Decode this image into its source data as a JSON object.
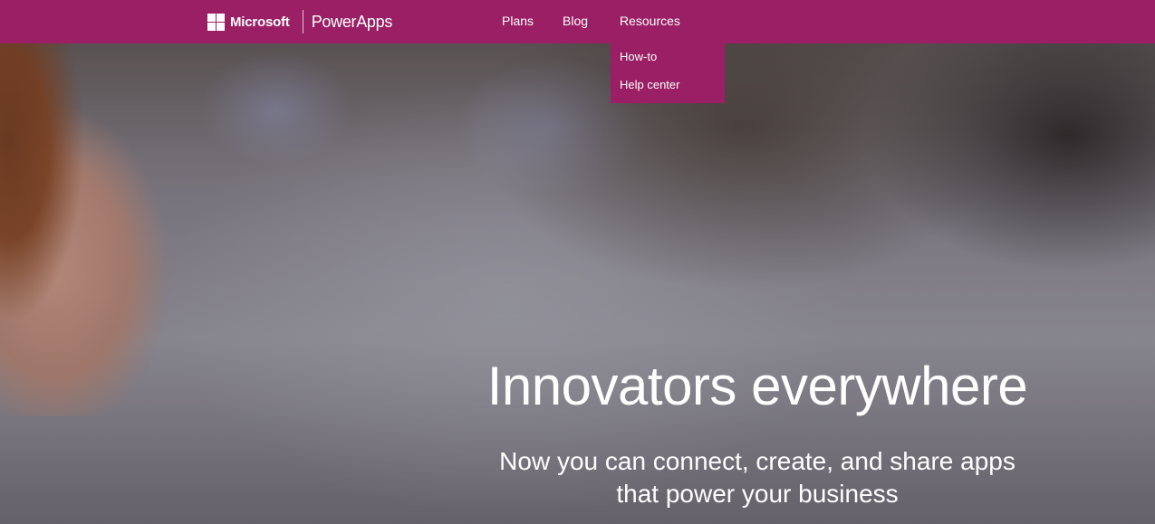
{
  "brand": {
    "company": "Microsoft",
    "product": "PowerApps",
    "logo_icon": "microsoft-four-squares-icon"
  },
  "nav": {
    "items": [
      {
        "label": "Plans"
      },
      {
        "label": "Blog"
      },
      {
        "label": "Resources"
      }
    ],
    "resources_menu": [
      {
        "label": "How-to"
      },
      {
        "label": "Help center"
      }
    ]
  },
  "hero": {
    "headline": "Innovators everywhere",
    "subhead_line1": "Now you can connect, create, and share apps",
    "subhead_line2": "that power your business"
  },
  "colors": {
    "brand_bar": "#9b1f64",
    "text": "#ffffff"
  }
}
